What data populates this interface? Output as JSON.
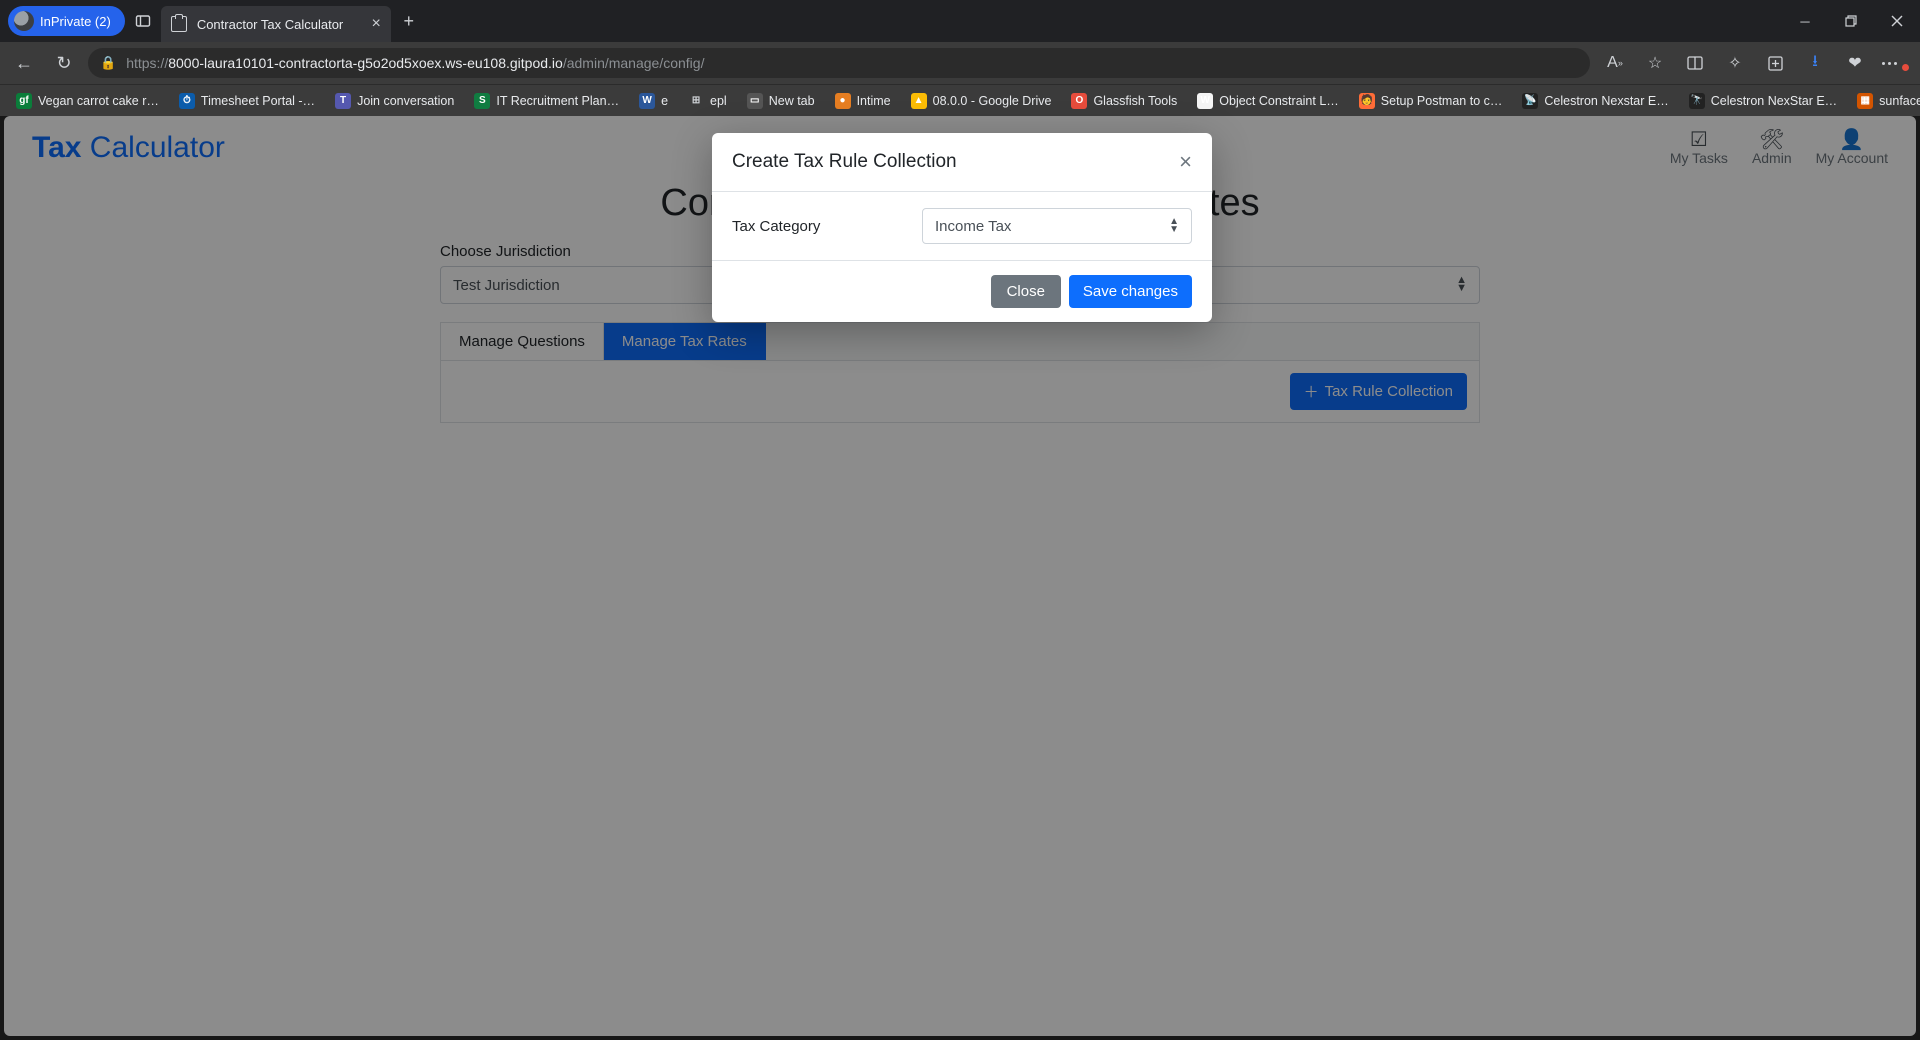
{
  "browser": {
    "inprivate_label": "InPrivate (2)",
    "tab_title": "Contractor Tax Calculator",
    "url_scheme": "https://",
    "url_host": "8000-laura10101-contractorta-g5o2od5xoex.ws-eu108.gitpod.io",
    "url_path": "/admin/manage/config/"
  },
  "bookmarks": [
    {
      "label": "Vegan carrot cake r…",
      "color": "#0a7d3a",
      "init": "gf"
    },
    {
      "label": "Timesheet Portal -…",
      "color": "#0b5cab",
      "init": "⏱"
    },
    {
      "label": "Join conversation",
      "color": "#5558af",
      "init": "T"
    },
    {
      "label": "IT Recruitment Plan…",
      "color": "#107c41",
      "init": "S"
    },
    {
      "label": "e",
      "color": "#2b579a",
      "init": "W"
    },
    {
      "label": "epl",
      "color": "",
      "init": "⊞"
    },
    {
      "label": "New tab",
      "color": "#555",
      "init": "▭"
    },
    {
      "label": "Intime",
      "color": "#e67e22",
      "init": "●"
    },
    {
      "label": "08.0.0 - Google Drive",
      "color": "#fbbc05",
      "init": "▲"
    },
    {
      "label": "Glassfish Tools",
      "color": "#e74c3c",
      "init": "O"
    },
    {
      "label": "Object Constraint L…",
      "color": "#f5f5f5",
      "init": "W"
    },
    {
      "label": "Setup Postman to c…",
      "color": "#ff6c37",
      "init": "🧑"
    },
    {
      "label": "Celestron Nexstar E…",
      "color": "#222",
      "init": "📡"
    },
    {
      "label": "Celestron NexStar E…",
      "color": "#222",
      "init": "🔭"
    },
    {
      "label": "sunface manual",
      "color": "#d35400",
      "init": "▦"
    }
  ],
  "app": {
    "brand_a": "Tax",
    "brand_b": " Calculator",
    "nav": {
      "my_tasks": "My Tasks",
      "admin": "Admin",
      "my_account": "My Account"
    },
    "page_title": "Configure Questions and Tax Rates",
    "jurisdiction_label": "Choose Jurisdiction",
    "jurisdiction_value": "Test Jurisdiction",
    "tab_manage_questions": "Manage Questions",
    "tab_manage_tax_rates": "Manage Tax Rates",
    "add_collection_btn": "Tax Rule Collection"
  },
  "modal": {
    "title": "Create Tax Rule Collection",
    "field_label": "Tax Category",
    "field_value": "Income Tax",
    "close": "Close",
    "save": "Save changes"
  }
}
